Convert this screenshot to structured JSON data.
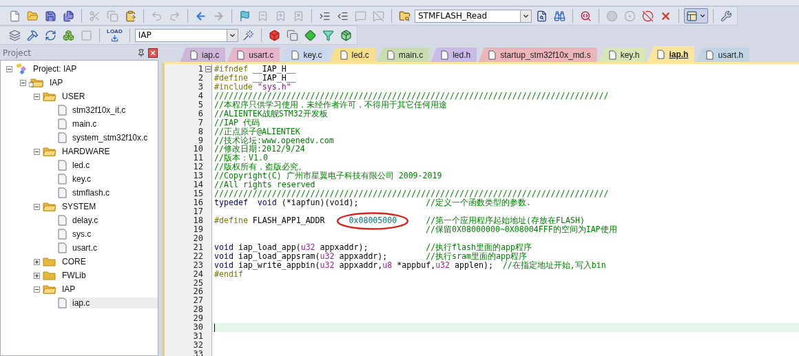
{
  "toolbar_1": [
    {
      "kind": "new-file",
      "disabled": false
    },
    {
      "kind": "open",
      "disabled": false
    },
    {
      "kind": "save",
      "disabled": false
    },
    {
      "kind": "save-all",
      "disabled": false
    },
    {
      "kind": "separator"
    },
    {
      "kind": "cut",
      "disabled": true
    },
    {
      "kind": "copy",
      "disabled": true
    },
    {
      "kind": "paste",
      "disabled": false
    },
    {
      "kind": "separator"
    },
    {
      "kind": "undo",
      "disabled": true
    },
    {
      "kind": "redo",
      "disabled": true
    },
    {
      "kind": "separator"
    },
    {
      "kind": "back",
      "disabled": false
    },
    {
      "kind": "forward",
      "disabled": true
    },
    {
      "kind": "separator"
    },
    {
      "kind": "bookmark",
      "disabled": false
    },
    {
      "kind": "bookmark-prev",
      "disabled": true
    },
    {
      "kind": "bookmark-next",
      "disabled": true
    },
    {
      "kind": "bookmark-clear",
      "disabled": true
    },
    {
      "kind": "separator"
    },
    {
      "kind": "indent",
      "disabled": false
    },
    {
      "kind": "unindent",
      "disabled": false
    },
    {
      "kind": "comment",
      "disabled": true
    },
    {
      "kind": "uncomment",
      "disabled": true
    },
    {
      "kind": "separator"
    },
    {
      "kind": "find-in-files",
      "disabled": false
    },
    {
      "kind": "combo",
      "value": "STMFLASH_Read"
    },
    {
      "kind": "find",
      "disabled": false
    },
    {
      "kind": "incremental-find",
      "disabled": false
    },
    {
      "kind": "separator"
    },
    {
      "kind": "debug",
      "disabled": false
    },
    {
      "kind": "separator"
    },
    {
      "kind": "breakpoint",
      "disabled": true
    },
    {
      "kind": "breakpoint-toggle",
      "disabled": true
    },
    {
      "kind": "breakpoint-enable",
      "disabled": false
    },
    {
      "kind": "breakpoint-kill",
      "disabled": false
    },
    {
      "kind": "separator"
    },
    {
      "kind": "windows",
      "disabled": false,
      "on": true
    },
    {
      "kind": "separator"
    },
    {
      "kind": "configure",
      "disabled": false
    }
  ],
  "toolbar_2": [
    {
      "kind": "translate",
      "disabled": false
    },
    {
      "kind": "build",
      "disabled": false
    },
    {
      "kind": "rebuild",
      "disabled": false
    },
    {
      "kind": "batch-build",
      "disabled": false
    },
    {
      "kind": "stop-build",
      "disabled": true
    },
    {
      "kind": "separator"
    },
    {
      "kind": "load",
      "label": "LOAD",
      "disabled": false
    },
    {
      "kind": "separator"
    },
    {
      "kind": "combo",
      "value": "IAP"
    },
    {
      "kind": "target-options",
      "disabled": false
    },
    {
      "kind": "separator"
    },
    {
      "kind": "components",
      "disabled": false
    },
    {
      "kind": "environment",
      "disabled": false
    },
    {
      "kind": "packs",
      "disabled": false
    },
    {
      "kind": "filter",
      "disabled": false
    },
    {
      "kind": "pack-installer",
      "disabled": false
    }
  ],
  "project_pane": {
    "title": "Project",
    "tree": [
      {
        "kind": "project",
        "label": "Project: IAP",
        "expanded": true,
        "selected": false,
        "children": [
          {
            "kind": "target",
            "label": "IAP",
            "expanded": true,
            "selected": false,
            "children": [
              {
                "kind": "group",
                "label": "USER",
                "expanded": true,
                "selected": false,
                "children": [
                  {
                    "kind": "file",
                    "label": "stm32f10x_it.c",
                    "selected": false
                  },
                  {
                    "kind": "file",
                    "label": "main.c",
                    "selected": false
                  },
                  {
                    "kind": "file",
                    "label": "system_stm32f10x.c",
                    "selected": false
                  }
                ]
              },
              {
                "kind": "group",
                "label": "HARDWARE",
                "expanded": true,
                "selected": false,
                "children": [
                  {
                    "kind": "file",
                    "label": "led.c",
                    "selected": false
                  },
                  {
                    "kind": "file",
                    "label": "key.c",
                    "selected": false
                  },
                  {
                    "kind": "file",
                    "label": "stmflash.c",
                    "selected": false
                  }
                ]
              },
              {
                "kind": "group",
                "label": "SYSTEM",
                "expanded": true,
                "selected": false,
                "children": [
                  {
                    "kind": "file",
                    "label": "delay.c",
                    "selected": false
                  },
                  {
                    "kind": "file",
                    "label": "sys.c",
                    "selected": false
                  },
                  {
                    "kind": "file",
                    "label": "usart.c",
                    "selected": false
                  }
                ]
              },
              {
                "kind": "group",
                "label": "CORE",
                "expanded": false,
                "selected": false
              },
              {
                "kind": "group",
                "label": "FWLib",
                "expanded": false,
                "selected": false
              },
              {
                "kind": "group",
                "label": "IAP",
                "expanded": true,
                "selected": false,
                "children": [
                  {
                    "kind": "file",
                    "label": "iap.c",
                    "selected": true
                  }
                ]
              }
            ]
          }
        ]
      }
    ]
  },
  "tabs": [
    {
      "label": "iap.c",
      "color": "#cdb6d8",
      "selected": false
    },
    {
      "label": "usart.c",
      "color": "#e6b5c9",
      "selected": false
    },
    {
      "label": "key.c",
      "color": "#c9d7ef",
      "selected": false
    },
    {
      "label": "led.c",
      "color": "#f5df8c",
      "selected": false
    },
    {
      "label": "main.c",
      "color": "#cbddb0",
      "selected": false
    },
    {
      "label": "led.h",
      "color": "#c9baea",
      "selected": false
    },
    {
      "label": "startup_stm32f10x_md.s",
      "color": "#ebb5b9",
      "selected": false
    },
    {
      "label": "key.h",
      "color": "#d8e5b5",
      "selected": false
    },
    {
      "label": "iap.h",
      "color": "#fbe59c",
      "selected": true
    },
    {
      "label": "usart.h",
      "color": "#c2d5e5",
      "selected": false
    }
  ],
  "code": {
    "lines": [
      {
        "number": "1",
        "fold": true,
        "current": false,
        "tokens": [
          {
            "kind": "pp",
            "text": "#ifndef"
          },
          {
            "kind": "text",
            "text": " __IAP_H__"
          }
        ]
      },
      {
        "number": "2",
        "fold": false,
        "current": false,
        "tokens": [
          {
            "kind": "pp",
            "text": "#define"
          },
          {
            "kind": "text",
            "text": " __IAP_H__"
          }
        ]
      },
      {
        "number": "3",
        "fold": false,
        "current": false,
        "tokens": [
          {
            "kind": "pp",
            "text": "#include"
          },
          {
            "kind": "string",
            "text": " \"sys.h\""
          }
        ]
      },
      {
        "number": "4",
        "fold": false,
        "current": false,
        "tokens": [
          {
            "kind": "comment",
            "text": "//////////////////////////////////////////////////////////////////////////////////"
          }
        ]
      },
      {
        "number": "5",
        "fold": false,
        "current": false,
        "tokens": [
          {
            "kind": "comment",
            "text": "//本程序只供学习使用，未经作者许可，不得用于其它任何用途"
          }
        ]
      },
      {
        "number": "6",
        "fold": false,
        "current": false,
        "tokens": [
          {
            "kind": "comment",
            "text": "//ALIENTEK战舰STM32开发板"
          }
        ]
      },
      {
        "number": "7",
        "fold": false,
        "current": false,
        "tokens": [
          {
            "kind": "comment",
            "text": "//IAP 代码"
          }
        ]
      },
      {
        "number": "8",
        "fold": false,
        "current": false,
        "tokens": [
          {
            "kind": "comment",
            "text": "//正点原子@ALIENTEK"
          }
        ]
      },
      {
        "number": "9",
        "fold": false,
        "current": false,
        "tokens": [
          {
            "kind": "comment",
            "text": "//技术论坛:www.openedv.com"
          }
        ]
      },
      {
        "number": "10",
        "fold": false,
        "current": false,
        "tokens": [
          {
            "kind": "comment",
            "text": "//修改日期:2012/9/24"
          }
        ]
      },
      {
        "number": "11",
        "fold": false,
        "current": false,
        "tokens": [
          {
            "kind": "comment",
            "text": "//版本：V1.0"
          }
        ]
      },
      {
        "number": "12",
        "fold": false,
        "current": false,
        "tokens": [
          {
            "kind": "comment",
            "text": "//版权所有，盗版必究。"
          }
        ]
      },
      {
        "number": "13",
        "fold": false,
        "current": false,
        "tokens": [
          {
            "kind": "comment",
            "text": "//Copyright(C) 广州市星翼电子科技有限公司 2009-2019"
          }
        ]
      },
      {
        "number": "14",
        "fold": false,
        "current": false,
        "tokens": [
          {
            "kind": "comment",
            "text": "//All rights reserved"
          }
        ]
      },
      {
        "number": "15",
        "fold": false,
        "current": false,
        "tokens": [
          {
            "kind": "comment",
            "text": "//////////////////////////////////////////////////////////////////////////////////"
          }
        ]
      },
      {
        "number": "16",
        "fold": false,
        "current": false,
        "tokens": [
          {
            "kind": "keyword",
            "text": "typedef  void"
          },
          {
            "kind": "text",
            "text": " (*iapfun)(void);              "
          },
          {
            "kind": "comment",
            "text": "//定义一个函数类型的参数."
          }
        ]
      },
      {
        "number": "17",
        "fold": false,
        "current": false
      },
      {
        "number": "18",
        "fold": false,
        "current": false,
        "tokens": [
          {
            "kind": "pp",
            "text": "#define"
          },
          {
            "kind": "text",
            "text": " FLASH_APP1_ADDR     "
          },
          {
            "kind": "number",
            "text": "0x08005000",
            "circled": true
          },
          {
            "kind": "comment",
            "text": "      //第一个应用程序起始地址(存放在FLASH)"
          }
        ]
      },
      {
        "number": "19",
        "fold": false,
        "current": false,
        "tokens": [
          {
            "kind": "comment",
            "text": "                                            //保留0X08000000~0X08004FFF的空间为IAP使用"
          }
        ]
      },
      {
        "number": "20",
        "fold": false,
        "current": false
      },
      {
        "number": "21",
        "fold": false,
        "current": false,
        "tokens": [
          {
            "kind": "keyword",
            "text": "void"
          },
          {
            "kind": "text",
            "text": " iap_load_app("
          },
          {
            "kind": "type",
            "text": "u32"
          },
          {
            "kind": "text",
            "text": " appxaddr);            "
          },
          {
            "kind": "comment",
            "text": "//执行flash里面的app程序"
          }
        ]
      },
      {
        "number": "22",
        "fold": false,
        "current": false,
        "tokens": [
          {
            "kind": "keyword",
            "text": "void"
          },
          {
            "kind": "text",
            "text": " iap_load_appsram("
          },
          {
            "kind": "type",
            "text": "u32"
          },
          {
            "kind": "text",
            "text": " appxaddr);        "
          },
          {
            "kind": "comment",
            "text": "//执行sram里面的app程序"
          }
        ]
      },
      {
        "number": "23",
        "fold": false,
        "current": false,
        "tokens": [
          {
            "kind": "keyword",
            "text": "void"
          },
          {
            "kind": "text",
            "text": " iap_write_appbin("
          },
          {
            "kind": "type",
            "text": "u32"
          },
          {
            "kind": "text",
            "text": " appxaddr,"
          },
          {
            "kind": "type",
            "text": "u8"
          },
          {
            "kind": "text",
            "text": " *appbuf,"
          },
          {
            "kind": "type",
            "text": "u32"
          },
          {
            "kind": "text",
            "text": " applen);  "
          },
          {
            "kind": "comment",
            "text": "//在指定地址开始,写入bin"
          }
        ]
      },
      {
        "number": "24",
        "fold": false,
        "current": false,
        "tokens": [
          {
            "kind": "pp",
            "text": "#endif"
          }
        ]
      },
      {
        "number": "25",
        "fold": false,
        "current": false
      },
      {
        "number": "26",
        "fold": false,
        "current": false
      },
      {
        "number": "27",
        "fold": false,
        "current": false
      },
      {
        "number": "28",
        "fold": false,
        "current": false
      },
      {
        "number": "29",
        "fold": false,
        "current": false
      },
      {
        "number": "30",
        "fold": false,
        "current": true
      },
      {
        "number": "31",
        "fold": false,
        "current": false
      },
      {
        "number": "32",
        "fold": false,
        "current": false
      },
      {
        "number": "33",
        "fold": false,
        "current": false
      }
    ]
  }
}
